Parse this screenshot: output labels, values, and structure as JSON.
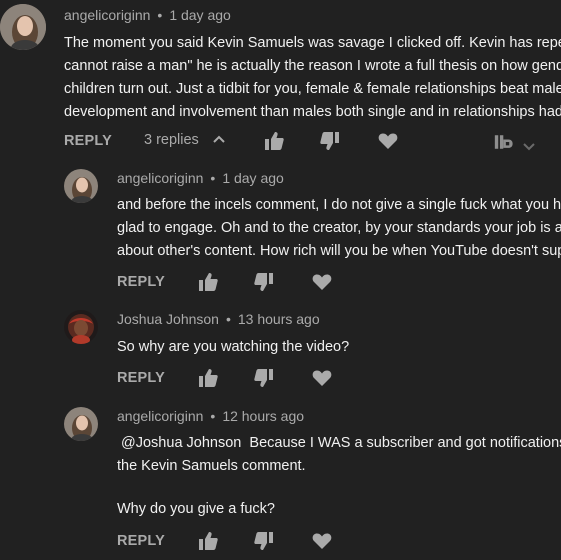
{
  "colors": {
    "background": "#212121",
    "text_primary": "#f1f1f1",
    "text_secondary": "#aaaaaa"
  },
  "comments": [
    {
      "author": "angelicoriginn",
      "time": "1 day ago",
      "lines": [
        "The moment you said Kevin Samuels was savage I clicked off. Kevin has repea",
        "cannot raise a man\" he is actually the reason I wrote a full thesis on how gende",
        "children turn out. Just a tidbit for you, female & female relationships beat male",
        "development and involvement than males both single and in relationships had."
      ],
      "reply_label": "REPLY",
      "replies_count": "3 replies",
      "like_icon": "thumbs-up-icon",
      "dislike_icon": "thumbs-down-icon",
      "heart_icon": "heart-icon",
      "extra_icon": "tubebuddy-icon",
      "extra_chevron": "chevron-down-icon"
    },
    {
      "author": "angelicoriginn",
      "time": "1 day ago",
      "lines": [
        "and before the incels comment, I do not give a single fuck what you ha",
        "glad to engage. Oh and to the creator, by your standards your job is als",
        "about other's content. How rich will you be when YouTube doesn't supp"
      ],
      "reply_label": "REPLY"
    },
    {
      "author": "Joshua Johnson",
      "time": "13 hours ago",
      "lines": [
        "So why are you watching the video?"
      ],
      "reply_label": "REPLY"
    },
    {
      "author": "angelicoriginn",
      "time": "12 hours ago",
      "lines": [
        " @Joshua Johnson  Because I WAS a subscriber and got notifications",
        "the Kevin Samuels comment.",
        "",
        "Why do you give a fuck?"
      ],
      "reply_label": "REPLY"
    }
  ]
}
